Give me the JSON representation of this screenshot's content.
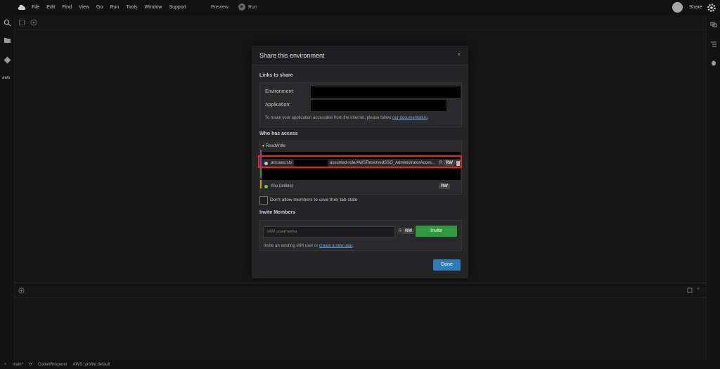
{
  "menu": [
    "File",
    "Edit",
    "Find",
    "View",
    "Go",
    "Run",
    "Tools",
    "Window",
    "Support"
  ],
  "toolbar": {
    "preview": "Preview",
    "run": "Run",
    "share": "Share"
  },
  "modal": {
    "title": "Share this environment",
    "close": "×",
    "links_title": "Links to share",
    "environment_label": "Environment:",
    "application_label": "Application:",
    "note_prefix": "To make your application accessible from the internet, please follow",
    "note_link": "our documentation",
    "note_suffix": ".",
    "who_title": "Who has access",
    "group": "ReadWrite",
    "member_prefix": "arn:aws:sts:",
    "member_role": "assumed-role/AWSReservedSSO_AdministratorAcces…",
    "you_label": "You (online)",
    "r": "R",
    "rw": "RW",
    "checkbox_label": "Don't allow members to save their tab state",
    "invite_title": "Invite Members",
    "input_placeholder": "IAM username",
    "invite_button": "Invite",
    "invite_note_prefix": "Invite an existing IAM user or",
    "invite_note_link": "create a new user",
    "invite_note_suffix": ".",
    "done": "Done"
  },
  "left_icons": [
    "search-icon",
    "folder-icon",
    "git-icon",
    "aws-icon"
  ],
  "left_aws_text": "aws",
  "status": {
    "branch": "main*",
    "codewhisperer": "CodeWhisperer",
    "aws_profile": "AWS: profile:default"
  },
  "colors": {
    "accent_green": "#2d9a3e",
    "accent_blue": "#2e7bb5",
    "highlight_red": "#e8281e"
  }
}
